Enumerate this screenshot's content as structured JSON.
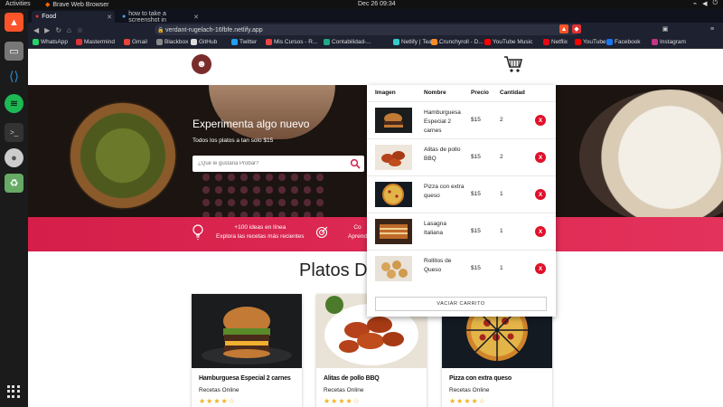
{
  "system": {
    "activities": "Activities",
    "app_name": "Brave Web Browser",
    "clock": "Dec 26  09:34"
  },
  "browser": {
    "tabs": [
      {
        "title": "Food"
      },
      {
        "title": "how to take a screenshot in"
      }
    ],
    "url": "verdant-rugelach-16fbfe.netlify.app",
    "bookmarks": [
      {
        "label": "WhatsApp",
        "color": "#25d366"
      },
      {
        "label": "Mastermind",
        "color": "#d33"
      },
      {
        "label": "Gmail",
        "color": "#ea4335"
      },
      {
        "label": "Blackbox",
        "color": "#888"
      },
      {
        "label": "GitHub",
        "color": "#ddd"
      },
      {
        "label": "Twitter",
        "color": "#1da1f2"
      },
      {
        "label": "Mis Cursos - R...",
        "color": "#e44"
      },
      {
        "label": "Contabilidad-...",
        "color": "#2a8"
      },
      {
        "label": "Netlify | Team...",
        "color": "#3cc"
      },
      {
        "label": "Crunchyroll - D...",
        "color": "#f78b24"
      },
      {
        "label": "YouTube Music",
        "color": "#f00"
      },
      {
        "label": "Netflix",
        "color": "#e50914"
      },
      {
        "label": "YouTube",
        "color": "#f00"
      },
      {
        "label": "Facebook",
        "color": "#1877f2"
      },
      {
        "label": "Instagram",
        "color": "#c13584"
      }
    ]
  },
  "hero": {
    "title": "Experimenta algo nuevo",
    "subtitle": "Todos los platos a tan solo $15",
    "search_placeholder": "¿Que le gustaria Probar?"
  },
  "features": [
    {
      "title": "+100 ideas en línea",
      "text": "Explora las recetas más recientes"
    },
    {
      "title": "Co",
      "text": "Aprend"
    }
  ],
  "section": {
    "title": "Platos D"
  },
  "cards": [
    {
      "name": "Hamburguesa Especial 2 carnes",
      "by": "Recetas Online",
      "stars": "★★★★☆"
    },
    {
      "name": "Alitas de pollo BBQ",
      "by": "Recetas Online",
      "stars": "★★★★☆"
    },
    {
      "name": "Pizza con extra queso",
      "by": "Recetas Online",
      "stars": "★★★★☆"
    }
  ],
  "cart": {
    "headers": {
      "image": "Imagen",
      "name": "Nombre",
      "price": "Precio",
      "qty": "Cantidad"
    },
    "items": [
      {
        "name": "Hamburguesa Especial 2 carnes",
        "price": "$15",
        "qty": "2",
        "delete": "X"
      },
      {
        "name": "Alitas de pollo BBQ",
        "price": "$15",
        "qty": "2",
        "delete": "X"
      },
      {
        "name": "Pizza con extra queso",
        "price": "$15",
        "qty": "1",
        "delete": "X"
      },
      {
        "name": "Lasagna Italiana",
        "price": "$15",
        "qty": "1",
        "delete": "X"
      },
      {
        "name": "Rollitos de Queso",
        "price": "$15",
        "qty": "1",
        "delete": "X"
      }
    ],
    "empty_button": "VACIAR CARRITO"
  },
  "colors": {
    "accent_red": "#d51f4a",
    "delete_red": "#e0102a",
    "star": "#f2b01e"
  }
}
